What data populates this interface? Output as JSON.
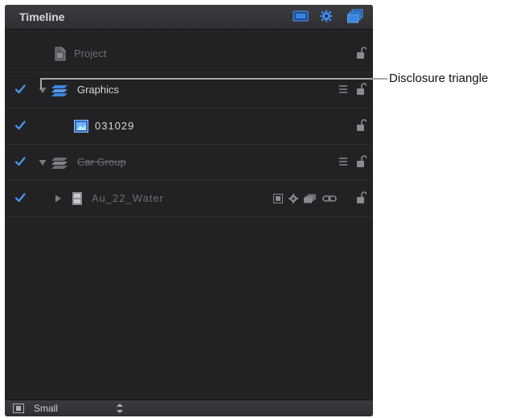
{
  "panel": {
    "title": "Timeline",
    "header_buttons": [
      "screen-icon",
      "gear-icon",
      "layers-icon"
    ],
    "accent": "#2f7bd8"
  },
  "rows": [
    {
      "label": "Project",
      "checked": false,
      "triangle": "none",
      "icon": "project-file-icon",
      "style": "dim"
    },
    {
      "label": "Graphics",
      "checked": true,
      "triangle": "expanded",
      "icon": "group-icon",
      "style": "bright"
    },
    {
      "label": "031029",
      "checked": true,
      "triangle": "none",
      "icon": "image-layer-icon",
      "style": "bright"
    },
    {
      "label": "Car Group",
      "checked": true,
      "triangle": "expanded",
      "icon": "group-icon",
      "style": "dim-strike"
    },
    {
      "label": "Au_22_Water",
      "checked": true,
      "triangle": "collapsed",
      "icon": "filmstrip-icon",
      "style": "dim"
    }
  ],
  "footer": {
    "size_label": "Small"
  },
  "callout": {
    "label": "Disclosure triangle"
  }
}
